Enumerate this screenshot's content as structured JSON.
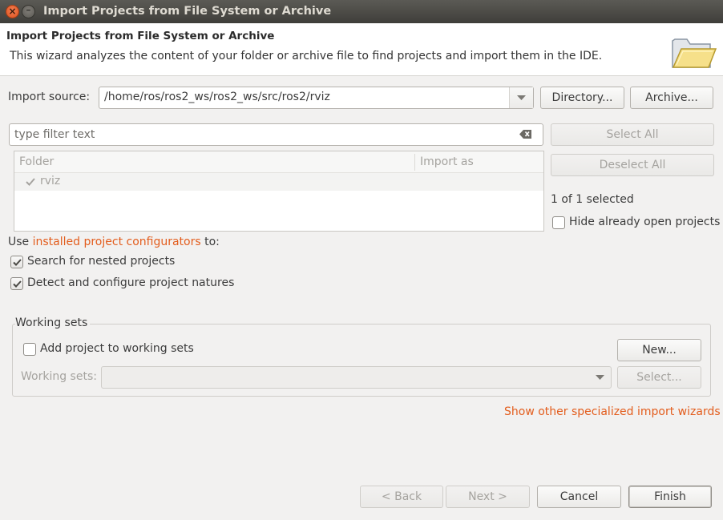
{
  "window": {
    "title": "Import Projects from File System or Archive"
  },
  "header": {
    "title": "Import Projects from File System or Archive",
    "description": "This wizard analyzes the content of your folder or archive file to find projects and import them in the IDE."
  },
  "source": {
    "label": "Import source:",
    "value": "/home/ros/ros2_ws/ros2_ws/src/ros2/rviz",
    "directory_button": "Directory...",
    "archive_button": "Archive..."
  },
  "filter": {
    "placeholder": "type filter text"
  },
  "table": {
    "columns": [
      "Folder",
      "Import as"
    ],
    "rows": [
      {
        "folder": "rviz",
        "import_as": "",
        "checked": true
      }
    ]
  },
  "selection": {
    "select_all": "Select All",
    "deselect_all": "Deselect All",
    "count": "1 of 1 selected",
    "hide_open": "Hide already open projects"
  },
  "configurators": {
    "prefix": "Use ",
    "link": "installed project configurators",
    "suffix": " to:",
    "nested": "Search for nested projects",
    "natures": "Detect and configure project natures"
  },
  "working_sets": {
    "group_title": "Working sets",
    "add_label": "Add project to working sets",
    "new_button": "New...",
    "sets_label": "Working sets:",
    "select_button": "Select..."
  },
  "other_wizards_link": "Show other specialized import wizards",
  "footer": {
    "back": "< Back",
    "next": "Next >",
    "cancel": "Cancel",
    "finish": "Finish"
  },
  "colors": {
    "link": "#e35d1d",
    "titlebar": "#3f3e3a",
    "close_button": "#e0521f"
  }
}
